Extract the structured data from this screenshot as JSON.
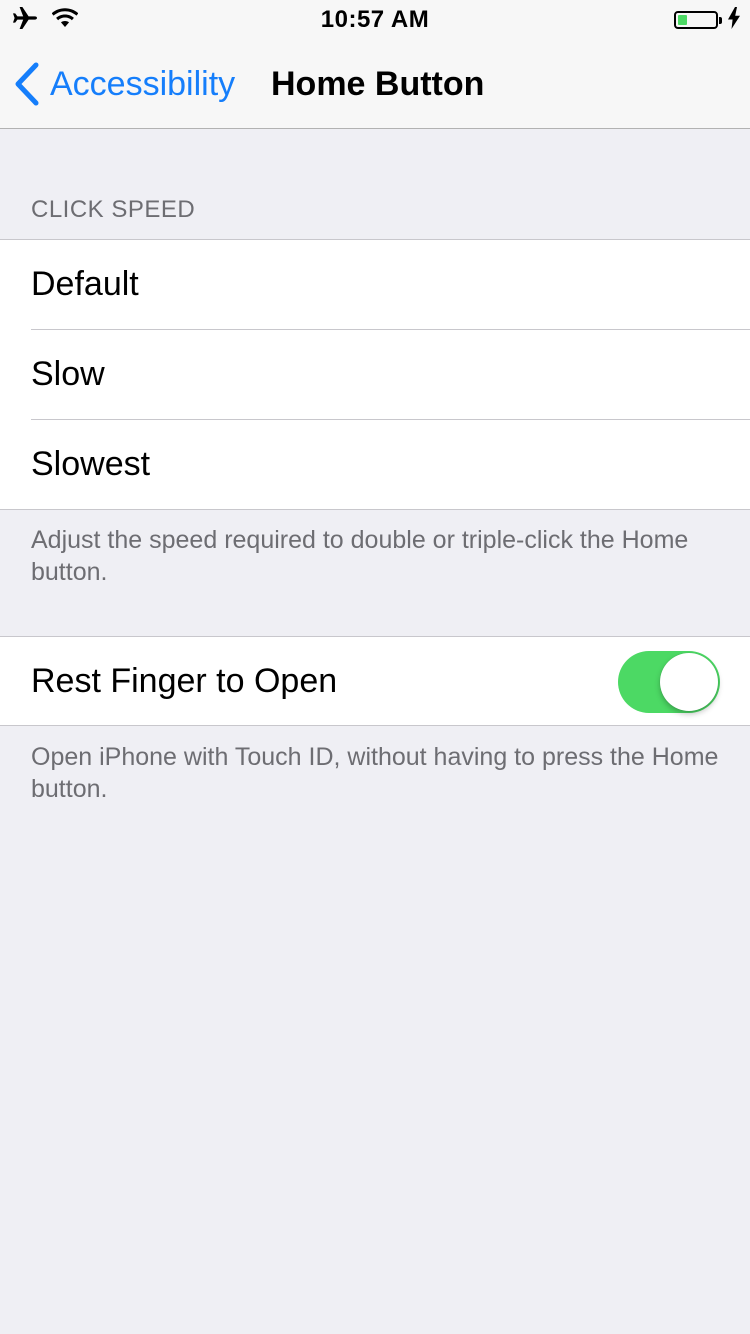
{
  "status_bar": {
    "time": "10:57 AM",
    "left_icons": [
      "airplane-icon",
      "wifi-icon"
    ],
    "right_icons": [
      "battery-icon",
      "charging-bolt-icon"
    ],
    "battery_level": 0.25,
    "battery_color": "#4cd964"
  },
  "nav": {
    "back_label": "Accessibility",
    "title": "Home Button",
    "accent_color": "#157efb"
  },
  "click_speed": {
    "header": "CLICK SPEED",
    "options": [
      {
        "label": "Default"
      },
      {
        "label": "Slow"
      },
      {
        "label": "Slowest"
      }
    ],
    "footer": "Adjust the speed required to double or triple-click the Home button."
  },
  "rest_finger": {
    "label": "Rest Finger to Open",
    "toggle_on": true,
    "toggle_color": "#4cd964",
    "footer": "Open iPhone with Touch ID, without having to press the Home button."
  }
}
